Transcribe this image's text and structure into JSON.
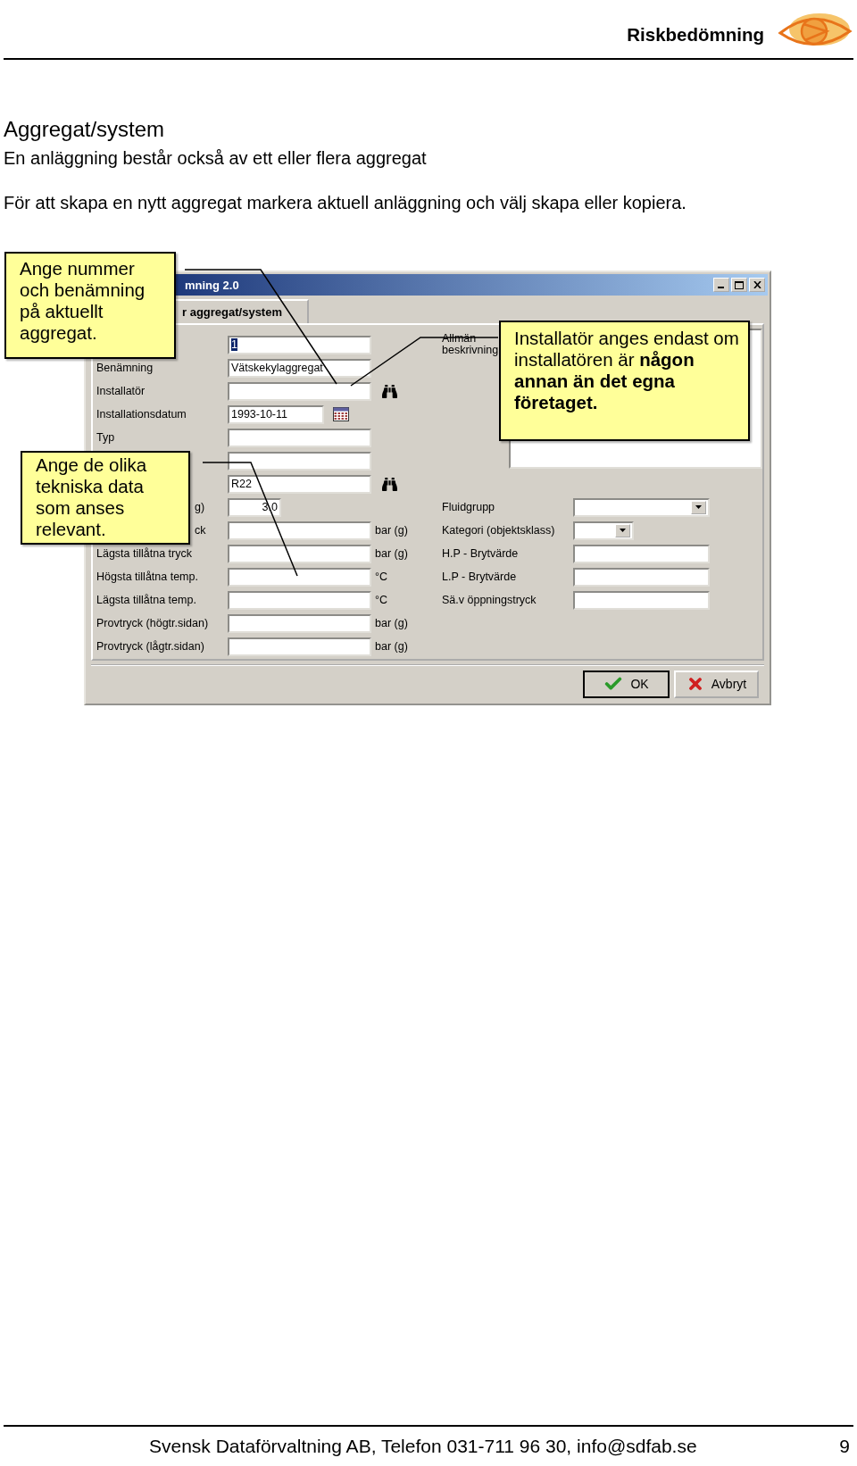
{
  "header": {
    "title": "Riskbedömning"
  },
  "heading": "Aggregat/system",
  "paragraphs": [
    "En anläggning består också av ett eller flera aggregat",
    "För att skapa en nytt aggregat markera aktuell anläggning och välj skapa eller kopiera."
  ],
  "dialog": {
    "title": "mning 2.0",
    "tabs": [
      {
        "label": "r aggregat/system",
        "selected": true
      }
    ],
    "fields": [
      {
        "value": "1",
        "highlighted": true,
        "kind": "text"
      },
      {
        "label": "Benämning",
        "value": "Vätskekylaggregat",
        "highlighted": false,
        "kind": "text"
      },
      {
        "label": "Installatör",
        "kind": "lookup"
      },
      {
        "label": "Installationsdatum",
        "value": "1993-10-11",
        "highlighted": false,
        "kind": "date"
      },
      {
        "label": "Typ",
        "kind": "text"
      },
      {
        "kind": "text"
      },
      {
        "value": "R22",
        "highlighted": false,
        "kind": "lookup"
      },
      {
        "label_end": "g)",
        "value": "3.0",
        "highlighted": false,
        "kind": "number"
      },
      {
        "label_end": "ck",
        "unit": "bar (g)",
        "kind": "text"
      },
      {
        "label": "Lägsta tillåtna tryck",
        "unit": "bar (g)",
        "kind": "text"
      },
      {
        "label": "Högsta tillåtna temp.",
        "unit": "°C",
        "kind": "text"
      },
      {
        "label": "Lägsta tillåtna temp.",
        "unit": "°C",
        "kind": "text"
      },
      {
        "label": "Provtryck (högtr.sidan)",
        "unit": "bar (g)",
        "kind": "text"
      },
      {
        "label": "Provtryck (lågtr.sidan)",
        "unit": "bar (g)",
        "kind": "text"
      }
    ],
    "description": {
      "label": "Allmän beskrivning"
    },
    "side_fields": [
      {
        "label": "Fluidgrupp",
        "kind": "select"
      },
      {
        "label": "Kategori (objektsklass)",
        "kind": "small-select"
      },
      {
        "label": "H.P - Brytvärde",
        "kind": "text"
      },
      {
        "label": "L.P - Brytvärde",
        "kind": "text"
      },
      {
        "label": "Sä.v öppningstryck",
        "kind": "text"
      }
    ],
    "buttons": [
      {
        "label": "OK",
        "kind": "ok"
      },
      {
        "label": "Avbryt",
        "kind": "cancel"
      }
    ]
  },
  "callouts": [
    {
      "text": "Ange nummer och benämning på aktuellt aggregat."
    },
    {
      "text": "Ange de olika tekniska data som anses relevant."
    },
    {
      "text": "Installatör anges endast om installatören är **någon annan än det egna företaget.**"
    }
  ],
  "footer": {
    "text": "Svensk Dataförvaltning AB, Telefon 031-711 96 30, info@sdfab.se",
    "page": "9"
  }
}
